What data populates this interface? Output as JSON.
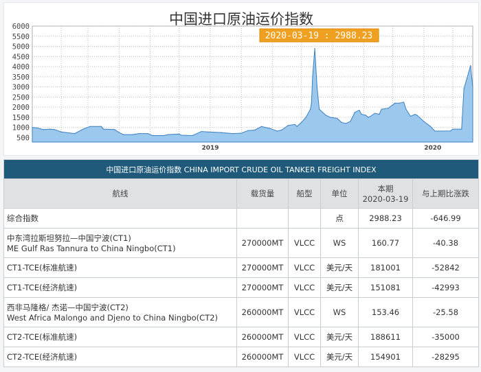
{
  "chart_data": {
    "type": "area",
    "title": "中国进口原油运价指数",
    "tooltip": "2020-03-19 : 2988.23",
    "ylim": [
      500,
      6000
    ],
    "yticks": [
      500,
      1000,
      1500,
      2000,
      2500,
      3000,
      3500,
      4000,
      4500,
      5000,
      5500,
      6000
    ],
    "xlim": [
      2018.2,
      2020.18
    ],
    "xticks": [
      {
        "x": 2019,
        "label": "2019"
      },
      {
        "x": 2020,
        "label": "2020"
      }
    ],
    "grid": true,
    "colors": {
      "fill": "#9cc8ee",
      "line": "#3a7fc0"
    },
    "x": [
      2018.2,
      2018.22,
      2018.25,
      2018.28,
      2018.3,
      2018.33,
      2018.39,
      2018.43,
      2018.46,
      2018.51,
      2018.52,
      2018.57,
      2018.59,
      2018.61,
      2018.65,
      2018.68,
      2018.72,
      2018.74,
      2018.79,
      2018.81,
      2018.86,
      2018.87,
      2018.92,
      2018.96,
      2018.99,
      2019.05,
      2019.1,
      2019.14,
      2019.17,
      2019.2,
      2019.23,
      2019.27,
      2019.3,
      2019.32,
      2019.35,
      2019.38,
      2019.39,
      2019.41,
      2019.43,
      2019.45,
      2019.455,
      2019.46,
      2019.47,
      2019.48,
      2019.49,
      2019.52,
      2019.54,
      2019.57,
      2019.59,
      2019.61,
      2019.63,
      2019.65,
      2019.67,
      2019.68,
      2019.7,
      2019.71,
      2019.72,
      2019.74,
      2019.76,
      2019.77,
      2019.8,
      2019.83,
      2019.85,
      2019.87,
      2019.88,
      2019.9,
      2019.92,
      2019.93,
      2019.96,
      2019.99,
      2020.01,
      2020.08,
      2020.09,
      2020.13,
      2020.14,
      2020.17,
      2020.18
    ],
    "y": [
      1000,
      980,
      900,
      920,
      900,
      780,
      700,
      930,
      1050,
      1050,
      920,
      900,
      750,
      650,
      650,
      700,
      700,
      600,
      600,
      650,
      680,
      620,
      600,
      800,
      780,
      750,
      700,
      720,
      850,
      870,
      1050,
      950,
      820,
      870,
      1100,
      1150,
      1050,
      1250,
      1500,
      1900,
      2200,
      3500,
      4900,
      3000,
      1900,
      1600,
      1500,
      1450,
      1250,
      1200,
      1300,
      1750,
      1850,
      1650,
      1600,
      1500,
      1550,
      1700,
      1650,
      1900,
      1950,
      2200,
      2200,
      2250,
      1900,
      1550,
      1650,
      1600,
      1300,
      1050,
      820,
      830,
      920,
      920,
      2900,
      4050,
      2988.23
    ]
  },
  "table": {
    "caption": "中国进口原油运价指数 CHINA IMPORT CRUDE OIL TANKER FREIGHT INDEX",
    "headers": [
      "航线",
      "载货量",
      "船型",
      "单位",
      "本期",
      "2020-03-19",
      "与上期比涨跌"
    ],
    "rows": [
      {
        "route": "综合指数",
        "route_en": "",
        "load": "",
        "ship": "",
        "unit": "点",
        "value": "2988.23",
        "change": "-646.99"
      },
      {
        "route": "中东湾拉斯坦努拉—中国宁波(CT1)",
        "route_en": "ME Gulf Ras Tannura to China Ningbo(CT1)",
        "load": "270000MT",
        "ship": "VLCC",
        "unit": "WS",
        "value": "160.77",
        "change": "-40.38"
      },
      {
        "route": "CT1-TCE(标准航速)",
        "route_en": "",
        "load": "270000MT",
        "ship": "VLCC",
        "unit": "美元/天",
        "value": "181001",
        "change": "-52842"
      },
      {
        "route": "CT1-TCE(经济航速)",
        "route_en": "",
        "load": "270000MT",
        "ship": "VLCC",
        "unit": "美元/天",
        "value": "151081",
        "change": "-42993"
      },
      {
        "route": "西非马隆格/ 杰诺—中国宁波(CT2)",
        "route_en": "West Africa Malongo and Djeno to China Ningbo(CT2)",
        "load": "260000MT",
        "ship": "VLCC",
        "unit": "WS",
        "value": "153.46",
        "change": "-25.58"
      },
      {
        "route": "CT2-TCE(标准航速)",
        "route_en": "",
        "load": "260000MT",
        "ship": "VLCC",
        "unit": "美元/天",
        "value": "188611",
        "change": "-35000"
      },
      {
        "route": "CT2-TCE(经济航速)",
        "route_en": "",
        "load": "260000MT",
        "ship": "VLCC",
        "unit": "美元/天",
        "value": "154901",
        "change": "-28295"
      }
    ]
  }
}
